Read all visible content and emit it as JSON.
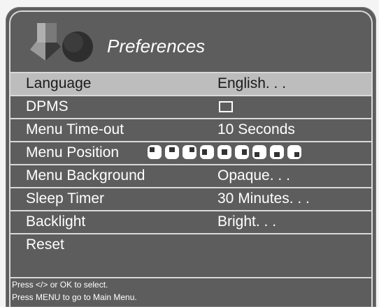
{
  "title": "Preferences",
  "menu": [
    {
      "label": "Language",
      "value": "English. . ."
    },
    {
      "label": "DPMS",
      "value": ""
    },
    {
      "label": "Menu Time-out",
      "value": "10 Seconds"
    },
    {
      "label": "Menu Position",
      "value": ""
    },
    {
      "label": "Menu Background",
      "value": "Opaque. . ."
    },
    {
      "label": "Sleep Timer",
      "value": "30 Minutes. . ."
    },
    {
      "label": "Backlight",
      "value": "Bright. . ."
    },
    {
      "label": "Reset",
      "value": ""
    }
  ],
  "dpms_checked": false,
  "position_options": [
    "top-left",
    "top-center",
    "top-right",
    "middle-left",
    "center",
    "middle-right",
    "bottom-left",
    "bottom-center",
    "bottom-right"
  ],
  "footer": {
    "line1": "Press </> or OK to select.",
    "line2": "Press MENU to go to Main Menu."
  }
}
